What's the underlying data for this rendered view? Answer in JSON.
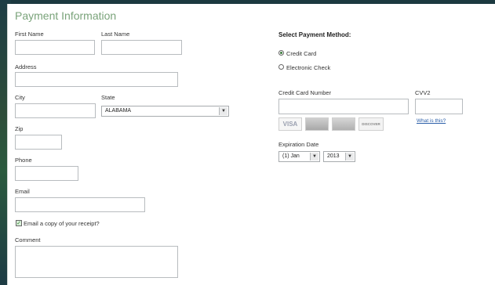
{
  "form": {
    "title": "Payment Information",
    "first_name_label": "First Name",
    "last_name_label": "Last Name",
    "address_label": "Address",
    "city_label": "City",
    "state_label": "State",
    "state_value": "ALABAMA",
    "zip_label": "Zip",
    "phone_label": "Phone",
    "email_label": "Email",
    "email_receipt_label": "Email a copy of your receipt?",
    "email_receipt_checked": true,
    "comment_label": "Comment"
  },
  "payment": {
    "heading": "Select Payment Method:",
    "options": [
      "Credit Card",
      "Electronic Check"
    ],
    "selected": "Credit Card",
    "card_number_label": "Credit Card Number",
    "cvv_label": "CVV2",
    "whats_this": "What is this?",
    "cards": [
      "VISA",
      "",
      "",
      "DISCOVER"
    ],
    "expiration_label": "Expiration Date",
    "month_value": "(1) Jan",
    "year_value": "2013"
  }
}
